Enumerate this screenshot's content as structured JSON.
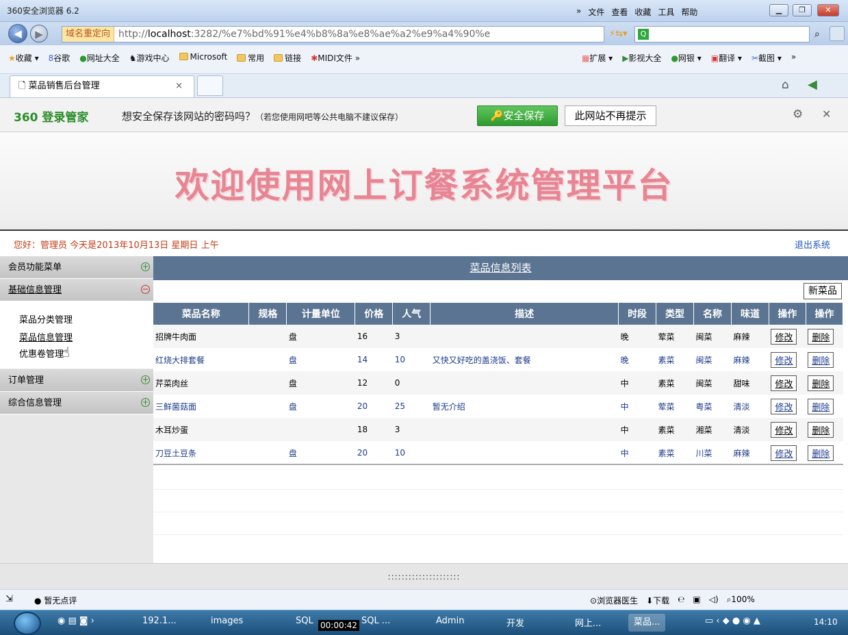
{
  "browser": {
    "title": "360安全浏览器 6.2",
    "menu": [
      "»",
      "文件",
      "查看",
      "收藏",
      "工具",
      "帮助"
    ],
    "address_tag": "域名重定向",
    "url_prefix": "http://",
    "url_host": "localhost",
    "url_rest": ":3282/%e7%bd%91%e4%b8%8a%e8%ae%a2%e9%a4%90%e",
    "favorites": [
      "收藏 ▾",
      "谷歌",
      "网址大全",
      "游戏中心",
      "Microsoft",
      "常用",
      "链接",
      "MIDI文件 »"
    ],
    "favorites_right": [
      "扩展 ▾",
      "影视大全",
      "网银 ▾",
      "翻译 ▾",
      "截图 ▾",
      "»"
    ],
    "tab_label": "菜品销售后台管理",
    "tab_close": "×"
  },
  "password_bar": {
    "logo": "360 登录管家",
    "message": "想安全保存该网站的密码吗？",
    "note": "（若您使用网吧等公共电脑不建议保存）",
    "save_button": "安全保存",
    "never_button": "此网站不再提示"
  },
  "page": {
    "banner": "欢迎使用网上订餐系统管理平台",
    "greeting": "您好：管理员  今天是2013年10月13日  星期日  上午",
    "logout": "退出系统",
    "list_title": "菜品信息列表",
    "new_button": "新菜品",
    "footer": ":::::::::::::::::::::"
  },
  "sidebar": {
    "sections": [
      {
        "label": "会员功能菜单",
        "state": "+"
      },
      {
        "label": "基础信息管理",
        "state": "−"
      },
      {
        "label": "订单管理",
        "state": "+"
      },
      {
        "label": "综合信息管理",
        "state": "+"
      }
    ],
    "sub_items": [
      "菜品分类管理",
      "菜品信息管理",
      "优惠卷管理"
    ]
  },
  "table": {
    "headers": [
      "菜品名称",
      "规格",
      "计量单位",
      "价格",
      "人气",
      "描述",
      "时段",
      "类型",
      "名称",
      "味道",
      "操作",
      "操作"
    ],
    "rows": [
      {
        "name": "招牌牛肉面",
        "spec": "",
        "unit": "盘",
        "price": "16",
        "pop": "3",
        "desc": "",
        "time": "晚",
        "type": "荤菜",
        "cuisine": "闽菜",
        "taste": "麻辣",
        "edit": "修改",
        "del": "删除"
      },
      {
        "name": "红烧大排套餐",
        "spec": "",
        "unit": "盘",
        "price": "14",
        "pop": "10",
        "desc": "又快又好吃的盖浇饭、套餐",
        "time": "晚",
        "type": "素菜",
        "cuisine": "闽菜",
        "taste": "麻辣",
        "edit": "修改",
        "del": "删除"
      },
      {
        "name": "芹菜肉丝",
        "spec": "",
        "unit": "盘",
        "price": "12",
        "pop": "0",
        "desc": "",
        "time": "中",
        "type": "素菜",
        "cuisine": "闽菜",
        "taste": "甜味",
        "edit": "修改",
        "del": "删除"
      },
      {
        "name": "三鲜菌菇面",
        "spec": "",
        "unit": "盘",
        "price": "20",
        "pop": "25",
        "desc": "暂无介绍",
        "time": "中",
        "type": "荤菜",
        "cuisine": "粤菜",
        "taste": "清淡",
        "edit": "修改",
        "del": "删除"
      },
      {
        "name": "木耳炒蛋",
        "spec": "",
        "unit": "",
        "price": "18",
        "pop": "3",
        "desc": "",
        "time": "中",
        "type": "素菜",
        "cuisine": "湘菜",
        "taste": "清淡",
        "edit": "修改",
        "del": "删除"
      },
      {
        "name": "刀豆土豆条",
        "spec": "",
        "unit": "盘",
        "price": "20",
        "pop": "10",
        "desc": "",
        "time": "中",
        "type": "素菜",
        "cuisine": "川菜",
        "taste": "麻辣",
        "edit": "修改",
        "del": "删除"
      }
    ]
  },
  "statusbar": {
    "left": "暂无点评",
    "right": [
      "浏览器医生",
      "下载",
      "100%"
    ]
  },
  "taskbar": {
    "items": [
      "192.1...",
      "images",
      "SQL",
      "SQL ...",
      "Admin",
      "开发",
      "网上...",
      "菜品..."
    ],
    "timer": "00:00:42",
    "clock": "14:10"
  }
}
